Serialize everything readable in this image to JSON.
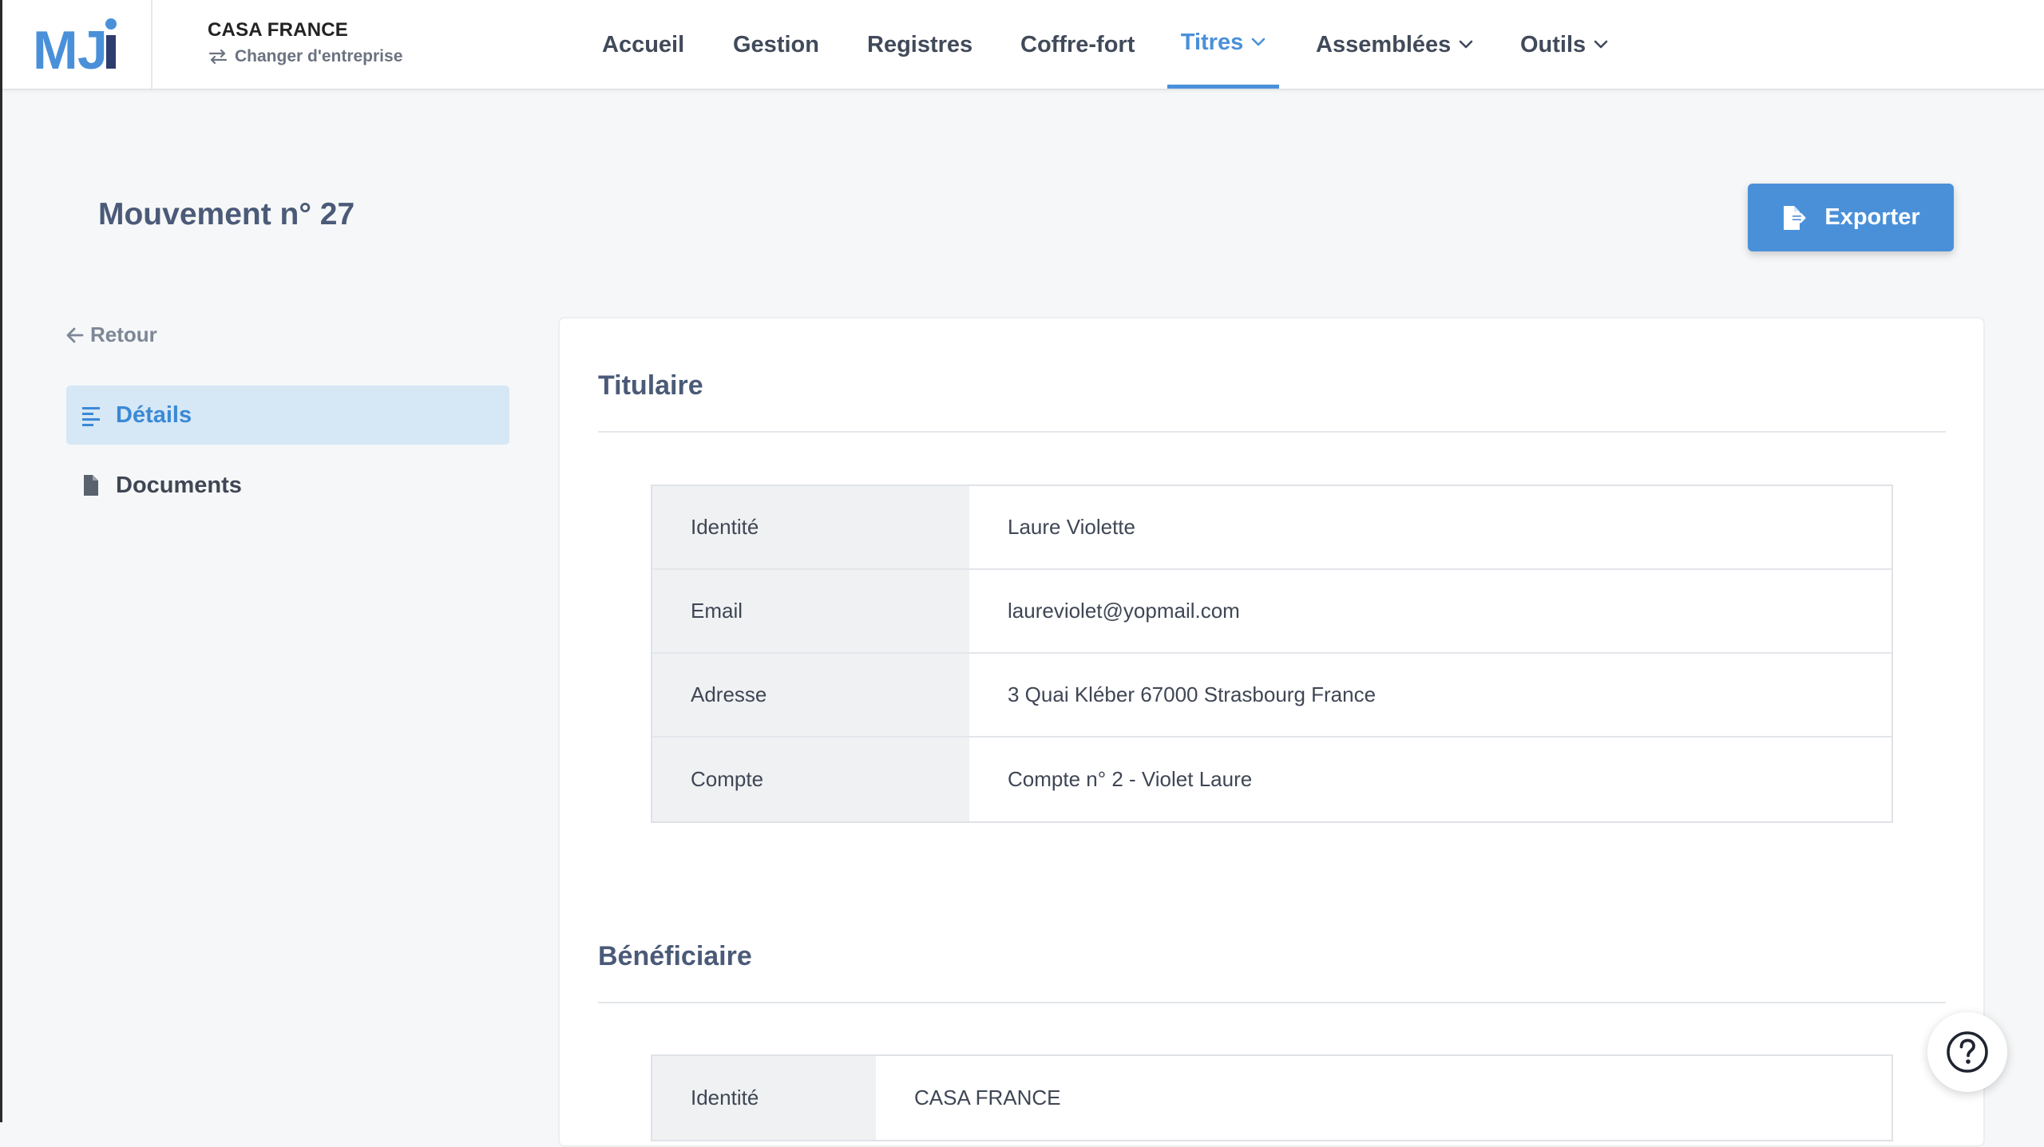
{
  "brand": {
    "logo_text": "MJi",
    "primary": "#4a90d9",
    "dark_navy": "#2d3d6e"
  },
  "company": {
    "name": "CASA FRANCE",
    "switch_label": "Changer d'entreprise"
  },
  "nav": {
    "items": [
      {
        "label": "Accueil",
        "has_dropdown": false,
        "active": false
      },
      {
        "label": "Gestion",
        "has_dropdown": false,
        "active": false
      },
      {
        "label": "Registres",
        "has_dropdown": false,
        "active": false
      },
      {
        "label": "Coffre-fort",
        "has_dropdown": false,
        "active": false
      },
      {
        "label": "Titres",
        "has_dropdown": true,
        "active": true
      },
      {
        "label": "Assemblées",
        "has_dropdown": true,
        "active": false
      },
      {
        "label": "Outils",
        "has_dropdown": true,
        "active": false
      }
    ]
  },
  "page": {
    "title": "Mouvement n° 27",
    "export_label": "Exporter"
  },
  "sidebar": {
    "back_label": "Retour",
    "items": [
      {
        "label": "Détails",
        "icon": "align-left-icon",
        "active": true
      },
      {
        "label": "Documents",
        "icon": "file-icon",
        "active": false
      }
    ]
  },
  "titulaire": {
    "title": "Titulaire",
    "rows": [
      {
        "label": "Identité",
        "value": "Laure Violette"
      },
      {
        "label": "Email",
        "value": "laureviolet@yopmail.com"
      },
      {
        "label": "Adresse",
        "value": "3 Quai Kléber 67000 Strasbourg France"
      },
      {
        "label": "Compte",
        "value": "Compte n° 2 - Violet Laure"
      }
    ]
  },
  "beneficiaire": {
    "title": "Bénéficiaire",
    "rows": [
      {
        "label": "Identité",
        "value": "CASA FRANCE"
      }
    ]
  },
  "help": {
    "icon": "question-circle-icon"
  }
}
